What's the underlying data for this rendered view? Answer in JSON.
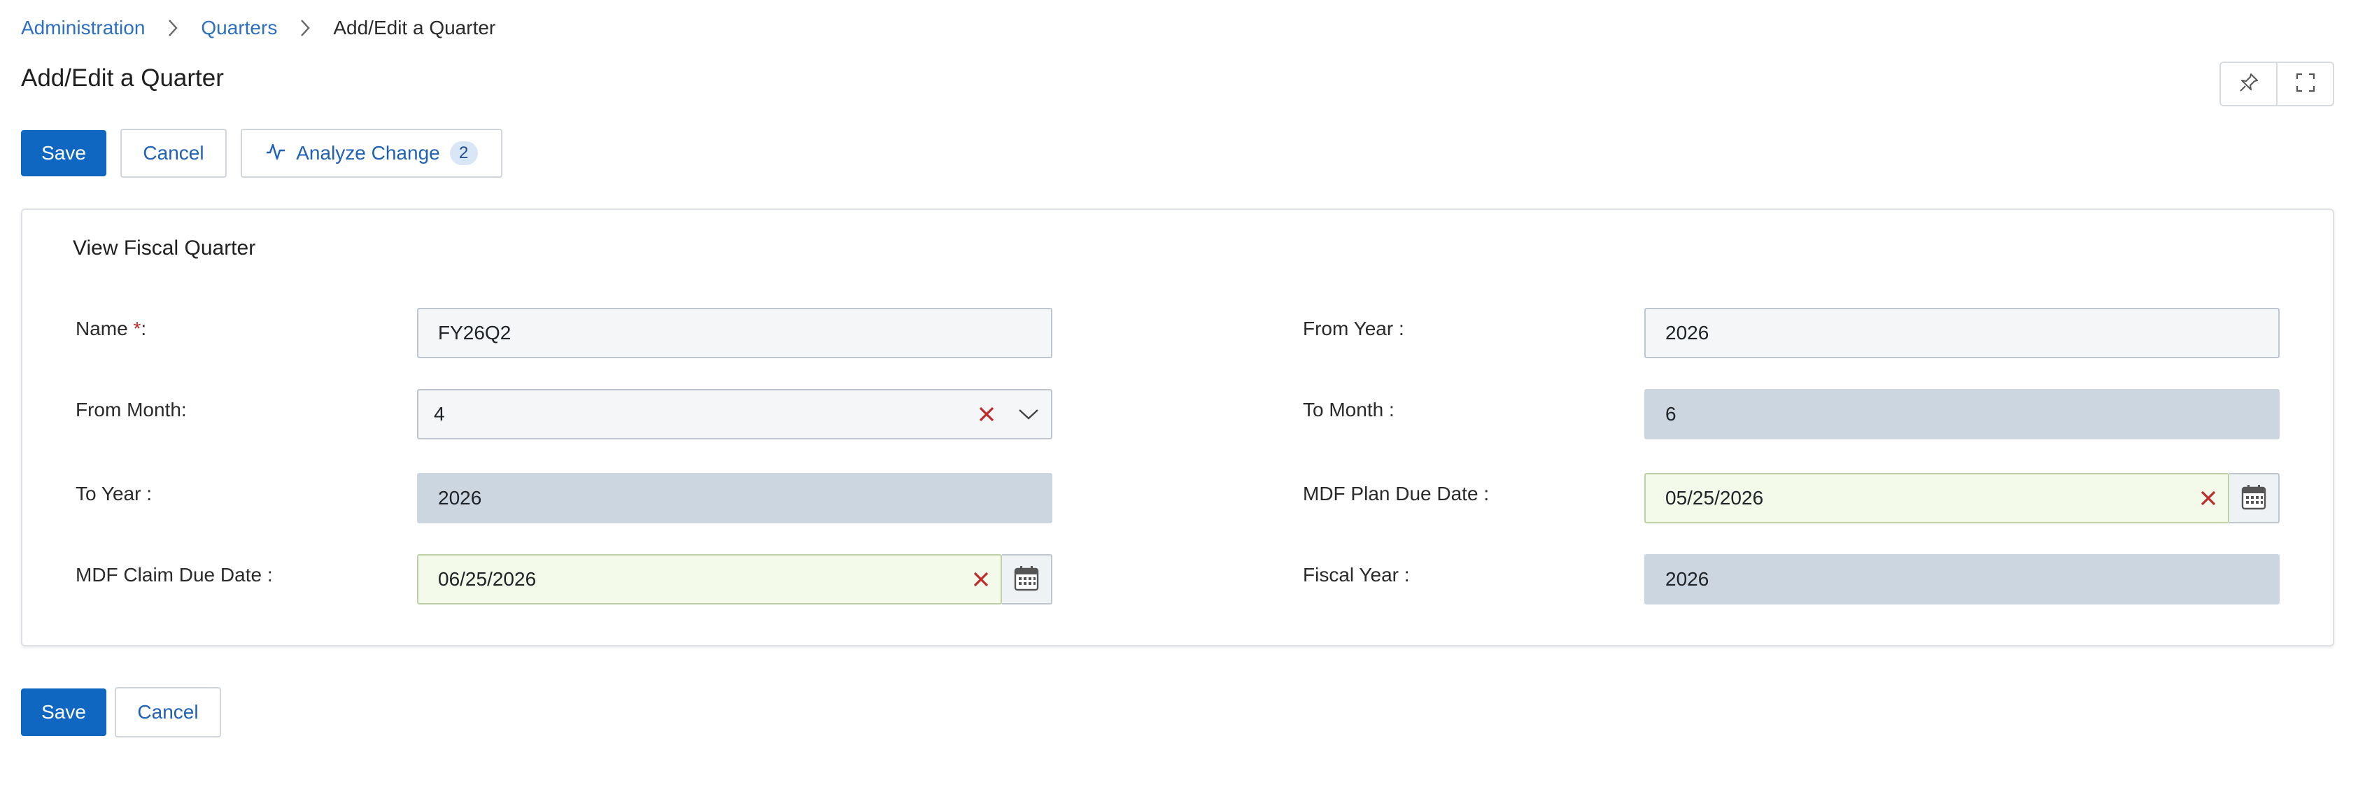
{
  "breadcrumb": {
    "items": [
      {
        "label": "Administration"
      },
      {
        "label": "Quarters"
      },
      {
        "label": "Add/Edit a Quarter"
      }
    ]
  },
  "page": {
    "title": "Add/Edit a Quarter"
  },
  "toolbar": {
    "save_label": "Save",
    "cancel_label": "Cancel",
    "analyze_label": "Analyze Change",
    "analyze_count": "2"
  },
  "corner_tools": {
    "pin_icon": "pin-icon",
    "expand_icon": "fullscreen-icon"
  },
  "form": {
    "section_title": "View Fiscal Quarter",
    "name": {
      "label": "Name ",
      "required_mark": "*",
      "suffix": ":",
      "value": "FY26Q2"
    },
    "from_year": {
      "label": "From Year :",
      "value": "2026"
    },
    "from_month": {
      "label": "From Month:",
      "value": "4"
    },
    "to_month": {
      "label": "To Month :",
      "value": "6"
    },
    "to_year": {
      "label": "To Year :",
      "value": "2026"
    },
    "mdf_plan_due_date": {
      "label": "MDF Plan Due Date :",
      "value": "05/25/2026"
    },
    "mdf_claim_due_date": {
      "label": "MDF Claim Due Date :",
      "value": "06/25/2026"
    },
    "fiscal_year": {
      "label": "Fiscal Year :",
      "value": "2026"
    }
  },
  "footer": {
    "save_label": "Save",
    "cancel_label": "Cancel"
  },
  "colors": {
    "primary": "#0f67c2",
    "link": "#2d6fc0",
    "clear": "#c22a2a",
    "readonly_bg": "#ccd6e0",
    "date_bg": "#f4faea"
  }
}
